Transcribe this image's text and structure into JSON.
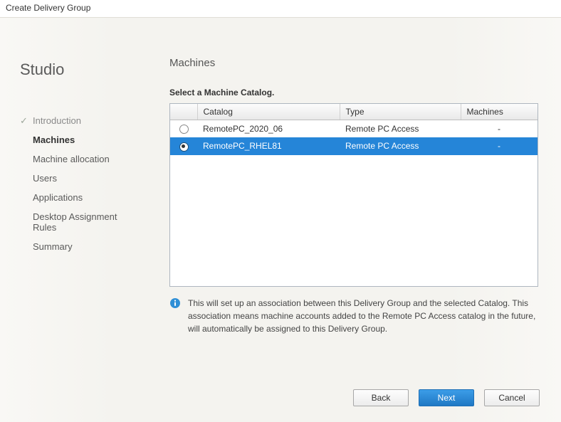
{
  "window_title": "Create Delivery Group",
  "sidebar": {
    "brand": "Studio",
    "steps": [
      {
        "label": "Introduction",
        "state": "completed"
      },
      {
        "label": "Machines",
        "state": "current"
      },
      {
        "label": "Machine allocation",
        "state": "upcoming"
      },
      {
        "label": "Users",
        "state": "upcoming"
      },
      {
        "label": "Applications",
        "state": "upcoming"
      },
      {
        "label": "Desktop Assignment Rules",
        "state": "upcoming"
      },
      {
        "label": "Summary",
        "state": "upcoming"
      }
    ]
  },
  "page": {
    "title": "Machines",
    "instruction": "Select a Machine Catalog.",
    "columns": {
      "catalog": "Catalog",
      "type": "Type",
      "machines": "Machines"
    },
    "catalogs": [
      {
        "name": "RemotePC_2020_06",
        "type": "Remote PC Access",
        "machines": "-",
        "selected": false
      },
      {
        "name": "RemotePC_RHEL81",
        "type": "Remote PC Access",
        "machines": "-",
        "selected": true
      }
    ],
    "info_text": "This will set up an association between this Delivery Group and the selected Catalog. This association means machine accounts added to the Remote PC Access catalog in the future, will automatically be assigned to this Delivery Group."
  },
  "footer": {
    "back": "Back",
    "next": "Next",
    "cancel": "Cancel"
  }
}
